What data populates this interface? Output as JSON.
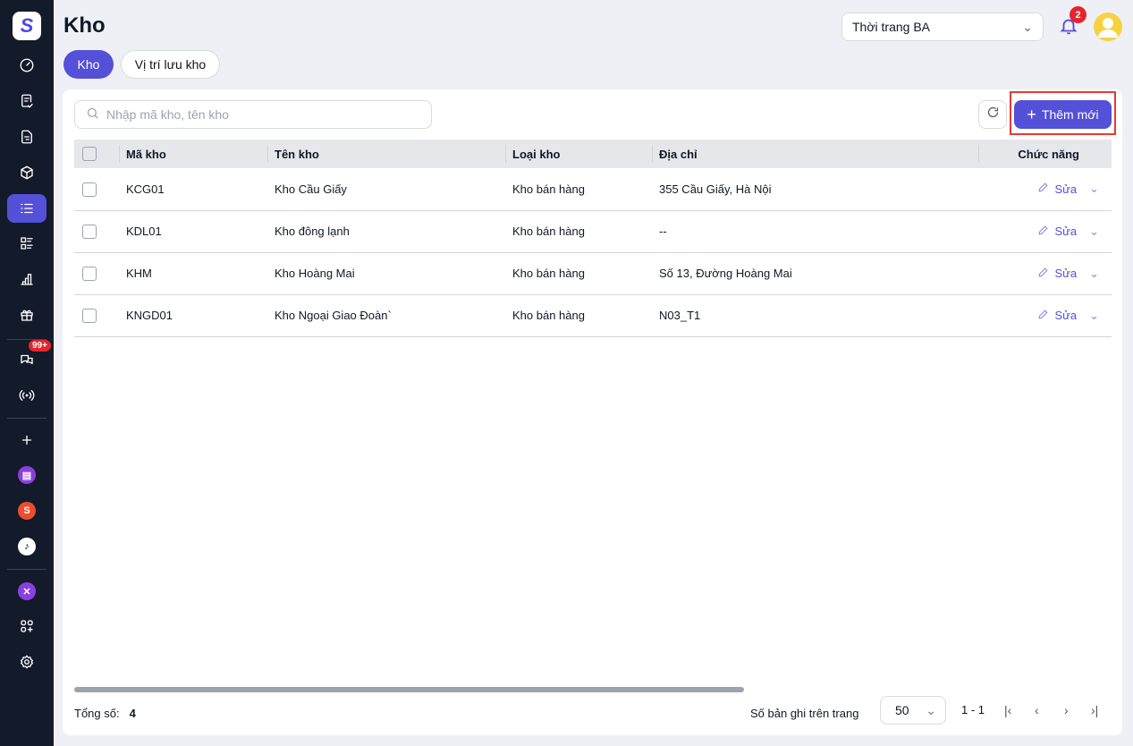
{
  "sidebar": {
    "chat_badge": "99+"
  },
  "header": {
    "title": "Kho",
    "store_select": "Thời trang BA",
    "notification_count": "2"
  },
  "tabs": [
    {
      "label": "Kho",
      "active": true
    },
    {
      "label": "Vị trí lưu kho",
      "active": false
    }
  ],
  "toolbar": {
    "search_placeholder": "Nhập mã kho, tên kho",
    "add_label": "Thêm mới"
  },
  "table": {
    "columns": [
      "Mã kho",
      "Tên kho",
      "Loại kho",
      "Địa chỉ",
      "Chức năng"
    ],
    "rows": [
      {
        "code": "KCG01",
        "name": "Kho Cầu Giấy",
        "type": "Kho bán hàng",
        "address": "355 Cầu Giấy, Hà Nội",
        "action": "Sửa"
      },
      {
        "code": "KDL01",
        "name": "Kho đông lạnh",
        "type": "Kho bán hàng",
        "address": "--",
        "action": "Sửa"
      },
      {
        "code": "KHM",
        "name": "Kho Hoàng Mai",
        "type": "Kho bán hàng",
        "address": "Số 13, Đường Hoàng Mai",
        "action": "Sửa"
      },
      {
        "code": "KNGD01",
        "name": "Kho Ngoại Giao Đoàn`",
        "type": "Kho bán hàng",
        "address": "N03_T1",
        "action": "Sửa"
      }
    ]
  },
  "footer": {
    "total_label": "Tổng số:",
    "total": "4",
    "per_page_label": "Số bản ghi trên trang",
    "per_page": "50",
    "range": "1 - 1"
  }
}
